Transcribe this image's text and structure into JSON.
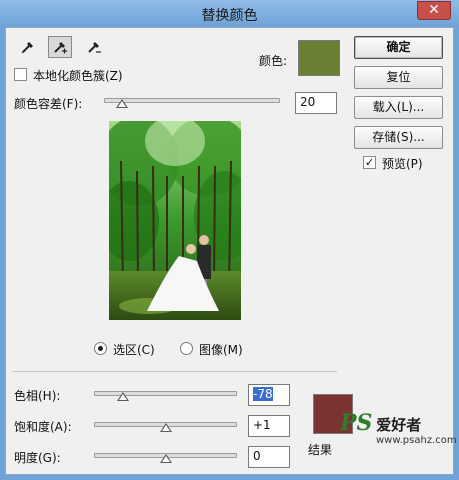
{
  "window": {
    "title": "替换颜色",
    "close_glyph": "✕"
  },
  "tools": [
    {
      "name": "eyedropper-icon",
      "active": false
    },
    {
      "name": "eyedropper-add-icon",
      "active": true
    },
    {
      "name": "eyedropper-subtract-icon",
      "active": false
    }
  ],
  "localized_clusters": {
    "label": "本地化颜色簇(Z)",
    "checked": false
  },
  "color": {
    "label": "颜色:",
    "swatch": "#6b7f34"
  },
  "fuzziness": {
    "label": "颜色容差(F):",
    "value": "20",
    "slider_fraction": 0.1
  },
  "buttons": {
    "ok": "确定",
    "reset": "复位",
    "load": "载入(L)...",
    "save": "存储(S)..."
  },
  "preview_check": {
    "label": "预览(P)",
    "checked": true,
    "mark": "✓"
  },
  "view_mode": {
    "selection": {
      "label": "选区(C)",
      "selected": true
    },
    "image": {
      "label": "图像(M)",
      "selected": false
    }
  },
  "replacement": {
    "hue": {
      "label": "色相(H):",
      "value": "-78",
      "slider_fraction": 0.2
    },
    "saturation": {
      "label": "饱和度(A):",
      "value": "+1",
      "slider_fraction": 0.5
    },
    "lightness": {
      "label": "明度(G):",
      "value": "0",
      "slider_fraction": 0.5
    },
    "result_label": "结果",
    "result_swatch": "#7a3330"
  },
  "watermark": {
    "ps": "PS",
    "brand": "爱好者",
    "url": "www.psahz.com"
  }
}
